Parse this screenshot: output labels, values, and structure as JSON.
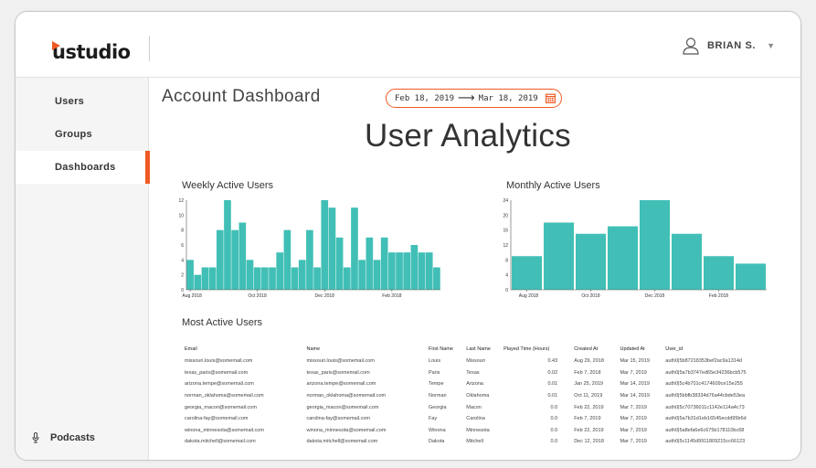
{
  "app": {
    "logo_text": "ustudio"
  },
  "user": {
    "name": "BRIAN S."
  },
  "sidebar": {
    "items": [
      {
        "label": "Users"
      },
      {
        "label": "Groups"
      },
      {
        "label": "Dashboards"
      }
    ],
    "bottom_item": {
      "label": "Podcasts",
      "icon": "microphone-icon"
    }
  },
  "header": {
    "title": "Account Dashboard",
    "date_range": {
      "start": "Feb 18, 2019",
      "end": "Mar 18, 2019",
      "icon": "calendar-icon"
    }
  },
  "section_title": "User Analytics",
  "colors": {
    "accent": "#ef5a24",
    "bar": "#41bfb6"
  },
  "chart_data": [
    {
      "type": "bar",
      "title": "Weekly Active Users",
      "ylim": [
        0,
        12
      ],
      "yticks": [
        0,
        2,
        4,
        6,
        8,
        10,
        12
      ],
      "xtick_labels": [
        {
          "label": "Aug 2018",
          "index": 0
        },
        {
          "label": "Oct 2018",
          "index": 9
        },
        {
          "label": "Dec 2018",
          "index": 18
        },
        {
          "label": "Feb 2018",
          "index": 27
        }
      ],
      "values": [
        4,
        2,
        3,
        3,
        8,
        12,
        8,
        9,
        4,
        3,
        3,
        3,
        5,
        8,
        3,
        4,
        8,
        3,
        12,
        11,
        7,
        3,
        11,
        4,
        7,
        4,
        7,
        5,
        5,
        5,
        6,
        5,
        5,
        3
      ]
    },
    {
      "type": "bar",
      "title": "Monthly Active Users",
      "ylim": [
        0,
        24
      ],
      "yticks": [
        0,
        4,
        8,
        12,
        16,
        20,
        24
      ],
      "xtick_labels": [
        {
          "label": "Aug 2018",
          "index": 0
        },
        {
          "label": "Oct 2018",
          "index": 2
        },
        {
          "label": "Dec 2018",
          "index": 4
        },
        {
          "label": "Feb 2018",
          "index": 6
        }
      ],
      "values": [
        9,
        18,
        15,
        17,
        24,
        15,
        9,
        7
      ]
    }
  ],
  "table": {
    "title": "Most Active Users",
    "columns": [
      "Email",
      "Name",
      "First Name",
      "Last Name",
      "Played Time (Hours)",
      "Created At",
      "Updated At",
      "User_id"
    ],
    "rows": [
      [
        "missouri.louis@somemail.com",
        "missouri.louis@somemail.com",
        "Louis",
        "Missouri",
        "0.43",
        "Aug 29, 2018",
        "Mar 15, 2019",
        "auth0|5b87218353bef2ac9a1314d"
      ],
      [
        "texas_paris@somemail.com",
        "texas_paris@somemail.com",
        "Paris",
        "Texas",
        "0.02",
        "Feb 7, 2018",
        "Mar 7, 2019",
        "auth0|5a7b3747ed65e34236bcb575"
      ],
      [
        "arizona.tempe@somemail.com",
        "arizona.tempe@somemail.com",
        "Tempe",
        "Arizona",
        "0.01",
        "Jan 25, 2019",
        "Mar 14, 2019",
        "auth0|5c4b701c4174609ce15e255"
      ],
      [
        "norman_oklahoma@somemail.com",
        "norman_oklahoma@somemail.com",
        "Norman",
        "Oklahoma",
        "0.01",
        "Oct 11, 2019",
        "Mar 14, 2019",
        "auth0|5bbfb38334d76a44cbde53ea"
      ],
      [
        "georgia_macon@somemail.com",
        "georgia_macon@somemail.com",
        "Georgia",
        "Macon",
        "0.0",
        "Feb 22, 2019",
        "Mar 7, 2019",
        "auth0|5c70736011c1142e114a4c73"
      ],
      [
        "carolina-fay@somemail.com",
        "carolina-fay@somemail.com",
        "Fay",
        "Carolina",
        "0.0",
        "Feb 7, 2019",
        "Mar 7, 2019",
        "auth0|5a7b31d1eb16545ecdd95b6d"
      ],
      [
        "winona_minnesota@somemail.com",
        "winona_minnesota@somemail.com",
        "Winona",
        "Minnesota",
        "0.0",
        "Feb 22, 2019",
        "Mar 7, 2019",
        "auth0|5a8efa6e6c675b178110bc68"
      ],
      [
        "dakota.mitchell@somemail.com",
        "dakota.mitchell@somemail.com",
        "Dakota",
        "Mitchell",
        "0.0",
        "Dec 12, 2018",
        "Mar 7, 2019",
        "auth0|5c1145d9911809215cc66123"
      ]
    ]
  }
}
